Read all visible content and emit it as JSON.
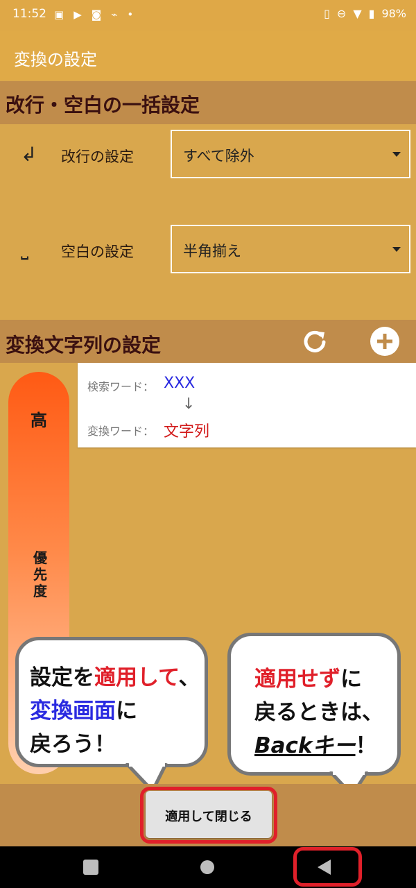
{
  "status_bar": {
    "time": "11:52",
    "battery": "98%",
    "icons": [
      "image-icon",
      "video-icon",
      "camera-icon",
      "cast-icon",
      "dot-icon"
    ],
    "right_icons": [
      "vibrate-icon",
      "dnd-icon",
      "wifi-icon",
      "battery-icon"
    ]
  },
  "app_bar": {
    "title": "変換の設定"
  },
  "bulk_section": {
    "title": "改行・空白の一括設定",
    "rows": [
      {
        "icon": "↲",
        "label": "改行の設定",
        "value": "すべて除外"
      },
      {
        "icon": "⎵",
        "label": "空白の設定",
        "value": "半角揃え"
      }
    ]
  },
  "conversion_section": {
    "title": "変換文字列の設定",
    "refresh_icon": "refresh-icon",
    "add_icon": "add-icon"
  },
  "priority": {
    "high": "高",
    "label": "優先度"
  },
  "entries": [
    {
      "search_label": "検索ワード：",
      "search_value": "XXX",
      "arrow": "↓",
      "replace_label": "変換ワード：",
      "replace_value": "文字列"
    }
  ],
  "bubbles": {
    "left": {
      "line1_a": "設定を",
      "line1_b": "適用して",
      "line1_c": "、",
      "line2_a": "変換画面",
      "line2_b": "に",
      "line3": "戻ろう！"
    },
    "right": {
      "line1_a": "適用せず",
      "line1_b": "に",
      "line2": "戻るときは、",
      "line3_a": "Backキー",
      "line3_b": "！"
    }
  },
  "apply_button": {
    "label": "適用して閉じる"
  },
  "colors": {
    "app_bar": "#e0aa47",
    "section_header": "#c08c4b",
    "background": "#d9a74d",
    "highlight": "#e0202a"
  }
}
